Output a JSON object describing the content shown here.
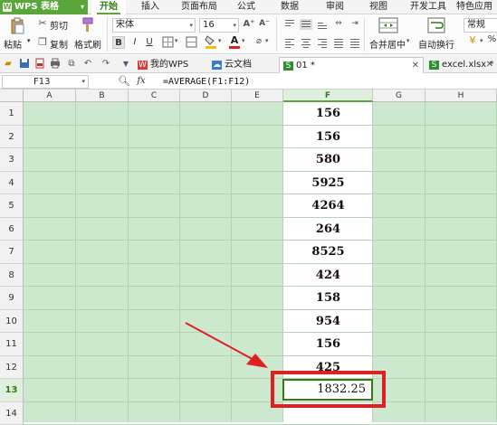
{
  "app": {
    "name": "WPS 表格",
    "logo_letter": "W"
  },
  "menu": [
    "开始",
    "插入",
    "页面布局",
    "公式",
    "数据",
    "审阅",
    "视图",
    "开发工具",
    "特色应用"
  ],
  "menu_active_index": 0,
  "ribbon": {
    "cut": "剪切",
    "paste": "粘贴",
    "copy": "复制",
    "format_painter": "格式刷",
    "font_name": "宋体",
    "font_size": "16",
    "bold": "B",
    "italic": "I",
    "underline": "U",
    "merge_center": "合并居中",
    "wrap_text": "自动换行",
    "number_format": "常规"
  },
  "tabs": [
    {
      "label": "我的WPS",
      "icon": "wps-icon"
    },
    {
      "label": "云文档",
      "icon": "cloud-icon"
    },
    {
      "label": "01 *",
      "icon": "sheet-icon",
      "active": true
    },
    {
      "label": "excel.xlsx *",
      "icon": "sheet-icon"
    }
  ],
  "formula_bar": {
    "cell_ref": "F13",
    "fx": "fx",
    "formula": "=AVERAGE(F1:F12)"
  },
  "columns": [
    "A",
    "B",
    "C",
    "D",
    "E",
    "F",
    "G",
    "H"
  ],
  "rows": [
    "1",
    "2",
    "3",
    "4",
    "5",
    "6",
    "7",
    "8",
    "9",
    "10",
    "11",
    "12",
    "13",
    "14"
  ],
  "selected_column": "F",
  "selected_row": "13",
  "column_f_values": [
    "156",
    "156",
    "580",
    "5925",
    "4264",
    "264",
    "8525",
    "424",
    "158",
    "954",
    "156",
    "425"
  ],
  "result_value": "1832.25",
  "colors": {
    "accent": "#5aa63a",
    "highlight": "#e02020",
    "grid_background": "#cce8cf"
  }
}
